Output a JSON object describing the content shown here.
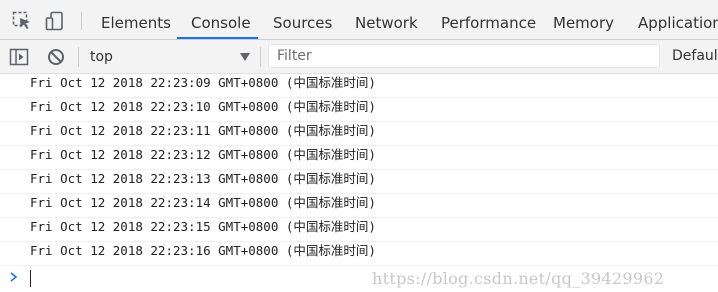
{
  "tabs": [
    {
      "label": "Elements",
      "active": false
    },
    {
      "label": "Console",
      "active": true
    },
    {
      "label": "Sources",
      "active": false
    },
    {
      "label": "Network",
      "active": false
    },
    {
      "label": "Performance",
      "active": false
    },
    {
      "label": "Memory",
      "active": false
    },
    {
      "label": "Application",
      "active": false
    }
  ],
  "toolbar": {
    "context": "top",
    "filter_placeholder": "Filter",
    "levels": "Default"
  },
  "console": {
    "logs": [
      "Fri Oct 12 2018 22:23:09 GMT+0800 (中国标准时间)",
      "Fri Oct 12 2018 22:23:10 GMT+0800 (中国标准时间)",
      "Fri Oct 12 2018 22:23:11 GMT+0800 (中国标准时间)",
      "Fri Oct 12 2018 22:23:12 GMT+0800 (中国标准时间)",
      "Fri Oct 12 2018 22:23:13 GMT+0800 (中国标准时间)",
      "Fri Oct 12 2018 22:23:14 GMT+0800 (中国标准时间)",
      "Fri Oct 12 2018 22:23:15 GMT+0800 (中国标准时间)",
      "Fri Oct 12 2018 22:23:16 GMT+0800 (中国标准时间)"
    ],
    "watermark": "https://blog.csdn.net/qq_39429962"
  },
  "colors": {
    "accent": "#1a73e8",
    "toolbar_bg": "#f3f3f3",
    "prompt": "#1a73e8"
  },
  "icons": {
    "inspect": "inspect-element-icon",
    "device": "device-toolbar-icon",
    "sidebar": "show-sidebar-icon",
    "clear": "clear-console-icon",
    "dropdown": "dropdown-arrow-icon",
    "prompt": "prompt-chevron-icon"
  }
}
